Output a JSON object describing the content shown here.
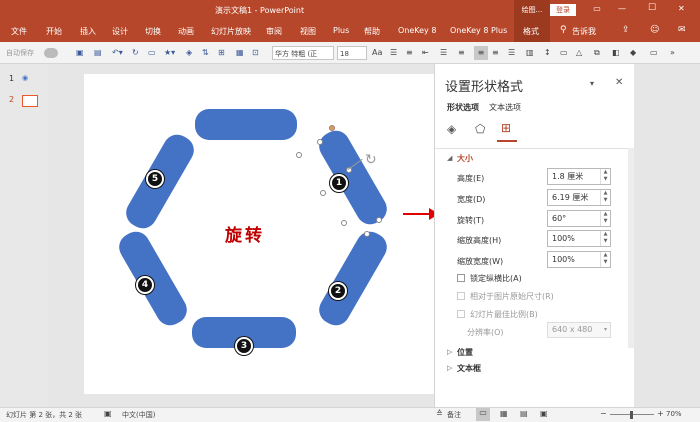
{
  "titlebar": {
    "autosave": "自动保存",
    "title": "演示文稿1 - PowerPoint",
    "drawing_tools": "绘图...",
    "login": "登录",
    "min": "—",
    "max": "☐",
    "close": "✕"
  },
  "tabs": [
    "文件",
    "开始",
    "插入",
    "设计",
    "切换",
    "动画",
    "幻灯片放映",
    "审阅",
    "视图",
    "Plus",
    "帮助",
    "OneKey 8",
    "OneKey 8 Plus",
    "格式"
  ],
  "tell_me": "告诉我",
  "toolbar": {
    "autosave_label": "自动保存",
    "font_name": "华方 特粗 (正",
    "font_size": "18",
    "font_aa": "Aa"
  },
  "slides": [
    {
      "num": "1"
    },
    {
      "num": "2"
    }
  ],
  "slide": {
    "center_text": "旋转",
    "badges": [
      "1",
      "2",
      "3",
      "4",
      "5"
    ]
  },
  "pane": {
    "title": "设置形状格式",
    "tab_shape": "形状选项",
    "tab_text": "文本选项",
    "section_size": "大小",
    "height_label": "高度(E)",
    "height_value": "1.8 厘米",
    "width_label": "宽度(D)",
    "width_value": "6.19 厘米",
    "rotation_label": "旋转(T)",
    "rotation_value": "60°",
    "scale_h_label": "缩放高度(H)",
    "scale_h_value": "100%",
    "scale_w_label": "缩放宽度(W)",
    "scale_w_value": "100%",
    "lock_aspect": "锁定纵横比(A)",
    "relative_original": "相对于图片原始尺寸(R)",
    "best_scale": "幻灯片最佳比例(B)",
    "resolution_label": "分辨率(O)",
    "resolution_value": "640 x 480",
    "section_position": "位置",
    "section_textbox": "文本框"
  },
  "status": {
    "slide_info": "幻灯片 第 2 张，共 2 张",
    "language": "中文(中国)",
    "notes": "备注",
    "zoom": "70%"
  },
  "colors": {
    "accent": "#b7472a",
    "shape_fill": "#4472c4",
    "text_red": "#c00000",
    "arrow_red": "#e00000"
  }
}
